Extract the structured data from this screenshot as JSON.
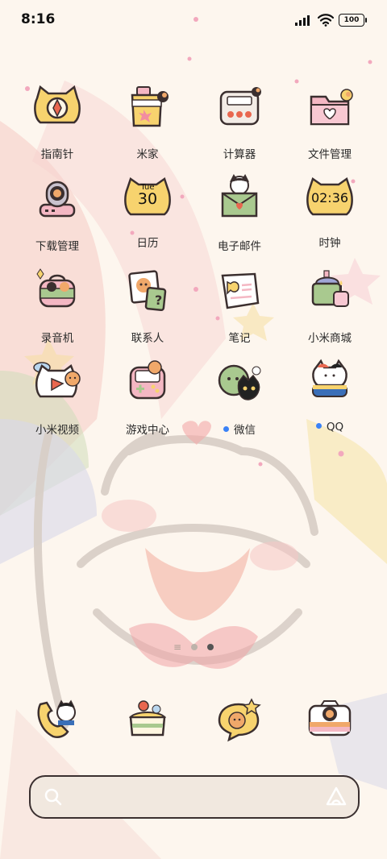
{
  "status": {
    "time": "8:16",
    "battery": "100"
  },
  "apps": [
    {
      "label": "指南针",
      "icon": "compass-cat-icon",
      "dot": false
    },
    {
      "label": "米家",
      "icon": "mijia-cup-icon",
      "dot": false
    },
    {
      "label": "计算器",
      "icon": "calculator-icon",
      "dot": false
    },
    {
      "label": "文件管理",
      "icon": "folder-heart-icon",
      "dot": false
    },
    {
      "label": "下载管理",
      "icon": "download-manager-icon",
      "dot": false
    },
    {
      "label": "日历",
      "icon": "calendar-cat-icon",
      "dot": false,
      "cal_day": "Tue",
      "cal_date": "30"
    },
    {
      "label": "电子邮件",
      "icon": "mail-cat-icon",
      "dot": false
    },
    {
      "label": "时钟",
      "icon": "clock-cat-icon",
      "dot": false,
      "clock_text": "02:36"
    },
    {
      "label": "录音机",
      "icon": "recorder-bag-icon",
      "dot": false
    },
    {
      "label": "联系人",
      "icon": "contacts-card-icon",
      "dot": false
    },
    {
      "label": "笔记",
      "icon": "notes-fish-icon",
      "dot": false
    },
    {
      "label": "小米商城",
      "icon": "cake-store-icon",
      "dot": false
    },
    {
      "label": "小米视频",
      "icon": "video-cat-icon",
      "dot": false
    },
    {
      "label": "游戏中心",
      "icon": "game-console-icon",
      "dot": false
    },
    {
      "label": "微信",
      "icon": "wechat-cat-icon",
      "dot": true
    },
    {
      "label": "QQ",
      "icon": "qq-cat-icon",
      "dot": true
    }
  ],
  "dock": [
    {
      "icon": "phone-cat-icon"
    },
    {
      "icon": "cake-message-icon"
    },
    {
      "icon": "chat-bubble-cat-icon"
    },
    {
      "icon": "camera-cat-icon"
    }
  ],
  "colors": {
    "accent_dot": "#3a82f7",
    "icon_yellow": "#f7d36e",
    "icon_green": "#a9c98f",
    "icon_pink": "#f4b7c3"
  }
}
